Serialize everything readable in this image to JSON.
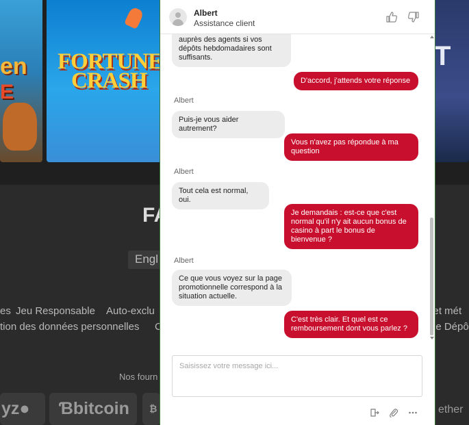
{
  "background": {
    "tile_left": {
      "line1": "en",
      "line2": "E"
    },
    "tile_mid": {
      "line1": "FORTUNE",
      "line2": "CRASH"
    },
    "tile_right": {
      "line1": "T"
    },
    "logo": "FA",
    "language": "Engl",
    "footer_links_row1": [
      "es",
      "Jeu Responsable",
      "Auto-exclu",
      "e et mét"
    ],
    "footer_links_row2": [
      "tion des données personnelles",
      "C",
      "de Dépô"
    ],
    "providers_label": "Nos fourn",
    "payment_logos": [
      "yz●",
      "Ɓbitcoin",
      "₿",
      "ether"
    ]
  },
  "chat": {
    "agent_name": "Albert",
    "agent_role": "Assistance client",
    "input_placeholder": "Saisissez votre message ici...",
    "messages": [
      {
        "from": "agent",
        "text": "auprès des agents si vos dépôts hebdomadaires sont suffisants."
      },
      {
        "from": "user",
        "text": "D'accord, j'attends votre réponse"
      },
      {
        "from": "agent",
        "sender": "Albert",
        "text": "Puis-je vous aider autrement?"
      },
      {
        "from": "user",
        "text": "Vous n'avez pas répondue à ma question"
      },
      {
        "from": "agent",
        "sender": "Albert",
        "text": "Tout cela est normal, oui."
      },
      {
        "from": "user",
        "text": "Je demandais : est-ce que c'est normal qu'il n'y ait aucun bonus de casino à part le bonus de bienvenue ?"
      },
      {
        "from": "agent",
        "sender": "Albert",
        "text": "Ce que vous voyez sur la page promotionnelle correspond à la situation actuelle."
      },
      {
        "from": "user",
        "text": "C'est très clair. Et quel est ce remboursement dont vous parlez ?"
      }
    ]
  },
  "colors": {
    "user_bubble": "#c8102e",
    "agent_bubble": "#ececec",
    "page_bg": "#2b2b2b"
  }
}
